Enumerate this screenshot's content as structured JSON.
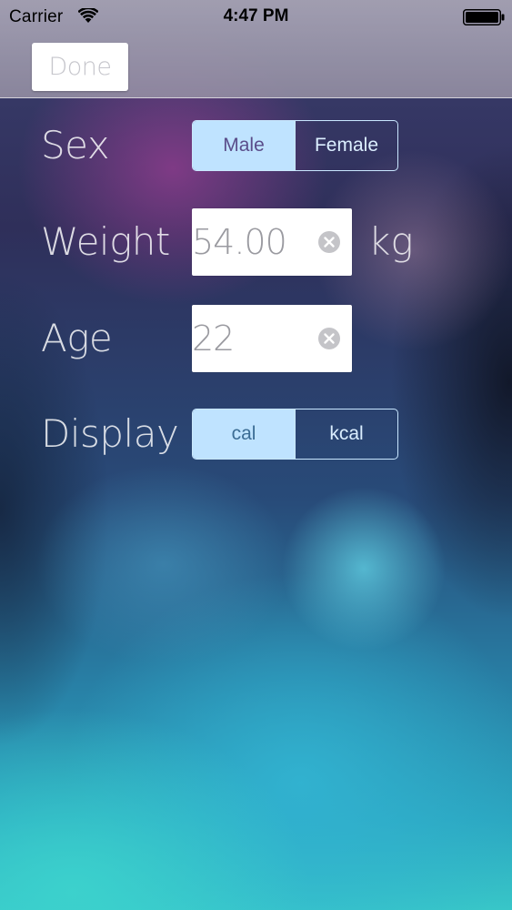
{
  "status_bar": {
    "carrier": "Carrier",
    "time": "4:47 PM",
    "wifi_icon": "wifi-icon",
    "battery_icon": "battery-icon"
  },
  "nav": {
    "done_label": "Done"
  },
  "form": {
    "sex": {
      "label": "Sex",
      "options": [
        "Male",
        "Female"
      ],
      "selected": "Male"
    },
    "weight": {
      "label": "Weight",
      "value": "54.00",
      "unit": "kg",
      "clear_icon": "clear-icon"
    },
    "age": {
      "label": "Age",
      "value": "22",
      "clear_icon": "clear-icon"
    },
    "display": {
      "label": "Display",
      "options": [
        "cal",
        "kcal"
      ],
      "selected": "cal"
    }
  },
  "colors": {
    "segment_tint": "#c9e7ff",
    "segment_selected_fill": "#bfe3ff",
    "topbar": "#a9a6b6"
  }
}
